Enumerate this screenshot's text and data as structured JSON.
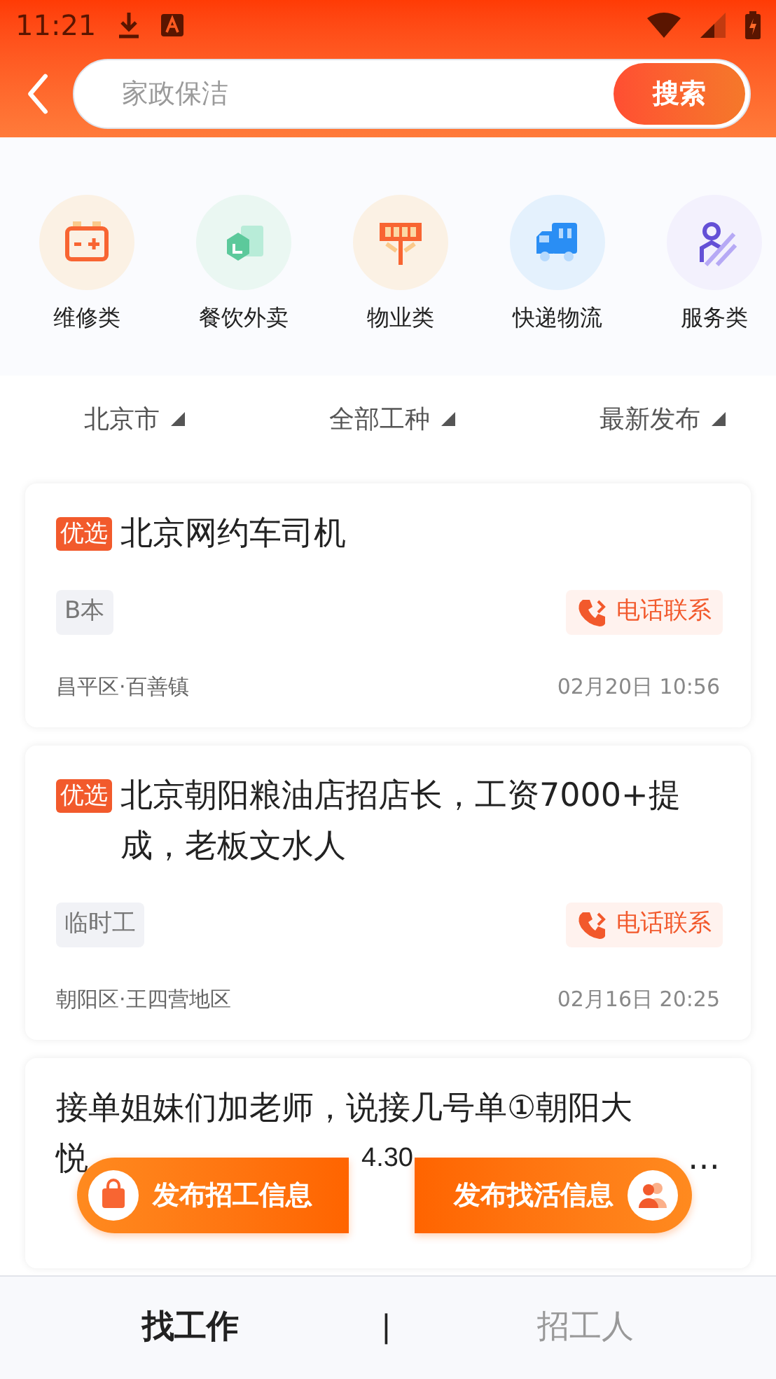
{
  "status_bar": {
    "time": "11:21"
  },
  "search": {
    "placeholder": "家政保洁",
    "button": "搜索"
  },
  "categories": [
    {
      "label": "维修类",
      "kind": "battery",
      "color": "#fbf1e4"
    },
    {
      "label": "餐饮外卖",
      "kind": "boxes",
      "color": "#eaf7f2"
    },
    {
      "label": "物业类",
      "kind": "sign",
      "color": "#fbf1e4"
    },
    {
      "label": "快递物流",
      "kind": "truck",
      "color": "#e4f1fd"
    },
    {
      "label": "服务类",
      "kind": "person",
      "color": "#f3f1fd"
    }
  ],
  "filters": [
    {
      "label": "北京市"
    },
    {
      "label": "全部工种"
    },
    {
      "label": "最新发布"
    }
  ],
  "jobs": [
    {
      "badge": "优选",
      "title": "北京网约车司机",
      "tag": "B本",
      "call": "电话联系",
      "location": "昌平区·百善镇",
      "date": "02月20日 10:56"
    },
    {
      "badge": "优选",
      "title": "北京朝阳粮油店招店长，工资7000+提成，老板文水人",
      "tag": "临时工",
      "call": "电话联系",
      "location": "朝阳区·王四营地区",
      "date": "02月16日 20:25"
    }
  ],
  "partial_job": {
    "title_line": "接单姐妹们加老师，说接几号单①朝阳大",
    "fragments": [
      "悦",
      "4.30",
      "…"
    ]
  },
  "floating_buttons": [
    {
      "label": "发布招工信息",
      "kind": "bag"
    },
    {
      "label": "发布找活信息",
      "kind": "people"
    }
  ],
  "bottom_tabs": [
    {
      "label": "找工作",
      "selected": true
    },
    {
      "label": "招工人",
      "selected": false
    }
  ],
  "tab_separator": "|"
}
